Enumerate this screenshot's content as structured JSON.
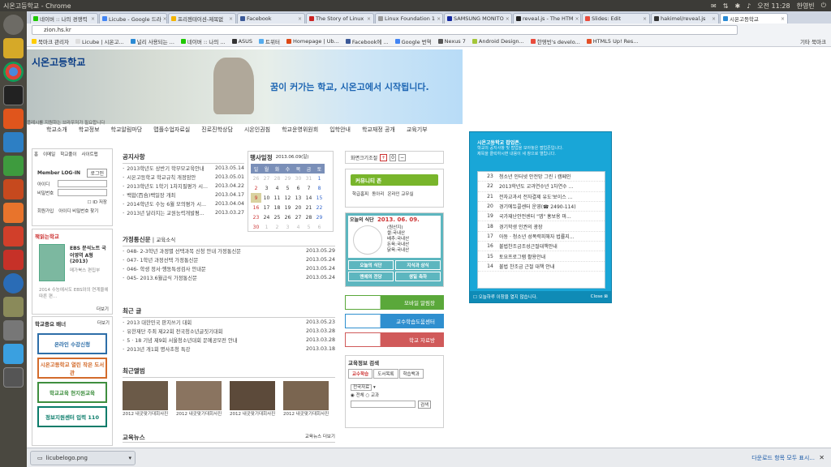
{
  "window": {
    "title": "시온고등학교 - Chrome",
    "clock": "오전 11:28",
    "user": "한영빈"
  },
  "tabs": [
    {
      "label": "네이버 :: 나의 경쟁력",
      "color": "#1ec800"
    },
    {
      "label": "Licube - Google 드라",
      "color": "#4285f4"
    },
    {
      "label": "프리젠테이션-제목없",
      "color": "#f4b400"
    },
    {
      "label": "Facebook",
      "color": "#3b5998"
    },
    {
      "label": "The Story of Linux",
      "color": "#cc2222"
    },
    {
      "label": "Linux Foundation 1",
      "color": "#999999"
    },
    {
      "label": "SAMSUNG MONITO",
      "color": "#1428a0"
    },
    {
      "label": "reveal.js - The HTM",
      "color": "#222222"
    },
    {
      "label": "Slides: Edit",
      "color": "#e94c3d"
    },
    {
      "label": "hakimel/reveal.js",
      "color": "#333333"
    },
    {
      "label": "시온고등학교",
      "color": "#2a8ad4"
    }
  ],
  "address": "zion.hs.kr",
  "bookmarks": [
    {
      "label": "북마크 관리자",
      "color": "#ffcc00"
    },
    {
      "label": "Licube | 시온고...",
      "color": "#dddddd"
    },
    {
      "label": "널리 사용되는 ...",
      "color": "#2a8ad4"
    },
    {
      "label": "네이버 :: 나의 ...",
      "color": "#1ec800"
    },
    {
      "label": "ASUS",
      "color": "#333333"
    },
    {
      "label": "트위터",
      "color": "#55acee"
    },
    {
      "label": "Homepage | Ub...",
      "color": "#dd4814"
    },
    {
      "label": "Facebook에 ...",
      "color": "#3b5998"
    },
    {
      "label": "Google 번역",
      "color": "#4285f4"
    },
    {
      "label": "Nexus 7",
      "color": "#555555"
    },
    {
      "label": "Android Design...",
      "color": "#a4c639"
    },
    {
      "label": "한영빈's develo...",
      "color": "#e94c3d"
    },
    {
      "label": "HTML5 Up! Res...",
      "color": "#e34f26"
    }
  ],
  "bookmarks_other": "기타 북마크",
  "site": {
    "logo": "시온고등학교",
    "slogan": "꿈이 커가는 학교, 시온고에서 시작됩니다.",
    "browser_note": "플레시를 지원하는 브라우저가 필요합니다",
    "gnb": [
      "학교소개",
      "학교정보",
      "학교알림마당",
      "맵플수업자료실",
      "진로진학상담",
      "시온인권침",
      "학교운영위원회",
      "입학안내",
      "학교재정 공개",
      "교육기부"
    ],
    "quick": [
      "홈",
      "이메일",
      "학교풀이",
      "사이트맵"
    ],
    "login": {
      "title": "Member LOG-IN",
      "button": "로그인",
      "id_label": "아이디",
      "pw_label": "비밀번호",
      "save": "ID 저장",
      "join": "회원가입",
      "find": "아이디 비밀번호 찾기"
    },
    "book": {
      "title": "책읽는학교",
      "name": "EBS 분석노트 국어영역 A형 (2013)",
      "pub": "메가북스 편집부",
      "desc": "2014 수능에서도 EBS와의 연계율에 따른 편...",
      "more": "더보기"
    },
    "banners_title": "학교중요 배너",
    "banners_more": "더보기",
    "banners": [
      "온라인 수강신청",
      "시온고등학교 열린 작은 도서관",
      "학교교육 현지원교육",
      "정보지원센터 입력 110"
    ],
    "notice": {
      "title": "공지사항",
      "items": [
        [
          "2013학년도 상반기 학부모교육안내",
          "2013.05.14"
        ],
        [
          "시온고등학교 학교규칙 개정암안",
          "2013.05.01"
        ],
        [
          "2013학년도 1학기 1차지필평가 시...",
          "2013.04.22"
        ],
        [
          "백합(百合)백일장 개최",
          "2013.04.17"
        ],
        [
          "2014학년도 수능 6월 모의평가 시...",
          "2013.04.04"
        ],
        [
          "2013년 달라지는 교원능력개발평...",
          "2013.03.27"
        ]
      ]
    },
    "schedule": {
      "title": "행사일정",
      "month": "2013.06.09(일)",
      "days": [
        "일",
        "월",
        "화",
        "수",
        "목",
        "금",
        "토"
      ],
      "weeks": [
        [
          "26",
          "27",
          "28",
          "29",
          "30",
          "31",
          "1"
        ],
        [
          "2",
          "3",
          "4",
          "5",
          "6",
          "7",
          "8"
        ],
        [
          "9",
          "10",
          "11",
          "12",
          "13",
          "14",
          "15"
        ],
        [
          "16",
          "17",
          "18",
          "19",
          "20",
          "21",
          "22"
        ],
        [
          "23",
          "24",
          "25",
          "26",
          "27",
          "28",
          "29"
        ],
        [
          "30",
          "1",
          "2",
          "3",
          "4",
          "5",
          "6"
        ]
      ]
    },
    "family": {
      "title": "가정통신문",
      "sub": "교육소식",
      "items": [
        [
          "048- 2-3학년 과정별 선택과목 신청 안내 가정통신문",
          "2013.05.29"
        ],
        [
          "047- 1학년 과정선택 가정통신문",
          "2013.05.24"
        ],
        [
          "046- 학생 정서·행동특성검사 안내문",
          "2013.05.24"
        ],
        [
          "045- 2013.6월급식 가정통신문",
          "2013.05.24"
        ]
      ]
    },
    "recent": {
      "title": "최근 글",
      "items": [
        [
          "2013 대한민국 판지쓰기 대회",
          "2013.05.23"
        ],
        [
          "유한재단 주최 제22회 전국청소년글짓기대회",
          "2013.03.28"
        ],
        [
          "5 · 18 기념 제9회 서울청소년대회 문예공모전 안내",
          "2013.03.28"
        ],
        [
          "2013년 개1회 명사초청 특강",
          "2013.03.18"
        ]
      ]
    },
    "album": {
      "title": "최근앨범",
      "caps": [
        "2012 내곳맞기대회사진",
        "2012 내곳맞기대회사진",
        "2012 내곳맞기대회사진",
        "2012 내곳맞기대회사진"
      ]
    },
    "edu_news": {
      "title": "교육뉴스",
      "more": "교육뉴스 더보기"
    },
    "zoom": {
      "label": "화면크기조절"
    },
    "community": "커뮤니티 존",
    "community_links": [
      "학급홈피",
      "동아리",
      "온라인 교무실"
    ],
    "meal": {
      "title": "오늘의 식단",
      "date": "2013. 06. 09.",
      "menu": [
        "(원산지)",
        "쌀:국내산",
        "배추:국내산",
        "돈육:국내산",
        "닭육:국내산"
      ],
      "btns": [
        "오늘의 식단",
        "지식과 상식",
        "엔에의 전당",
        "생일 축하"
      ]
    },
    "links": [
      "모바일 알림장",
      "교수학습도움센터",
      "학교 자료방"
    ],
    "search": {
      "title": "교육정보 검색",
      "tabs": [
        "교수학습",
        "도서목록",
        "학습백과"
      ],
      "select": "전국자료",
      "radio1": "전체",
      "radio2": "교과",
      "button": "검색"
    }
  },
  "popup": {
    "title": "시온고등학교 팝업존.",
    "desc1": "학교의 공지사항 및 팝업을 모아놓은 팝업존입니다.",
    "desc2": "제목을 클릭하시면 내용이 새 창으로 열립니다.",
    "rows": [
      [
        "23",
        "청소년 인터넷 안전망 그린 i 캠페인"
      ],
      [
        "22",
        "2013학년도 교과연수년 1차연수 ..."
      ],
      [
        "21",
        "전자교과서 전자결제 유도'보이스 ..."
      ],
      [
        "20",
        "경기에듀콜센터 운영(☎ 2490-114)"
      ],
      [
        "19",
        "국가재난안전센터 \"앱\" 홍보용 마..."
      ],
      [
        "18",
        "경기학생 인권의 광장"
      ],
      [
        "17",
        "아동 · 청소년 성폭력피해자 법률지..."
      ],
      [
        "16",
        "불법찬조금조성근절대책안내"
      ],
      [
        "15",
        "토요프로그램 활용안내"
      ],
      [
        "14",
        "불법 찬조금 근절 대책 안내"
      ]
    ],
    "footer_check": "오늘하루 이창을 열지 않습니다.",
    "close": "Close"
  },
  "status": {
    "download": "licubelogo.png",
    "show_all": "다운로드 항목 모두 표시..."
  }
}
